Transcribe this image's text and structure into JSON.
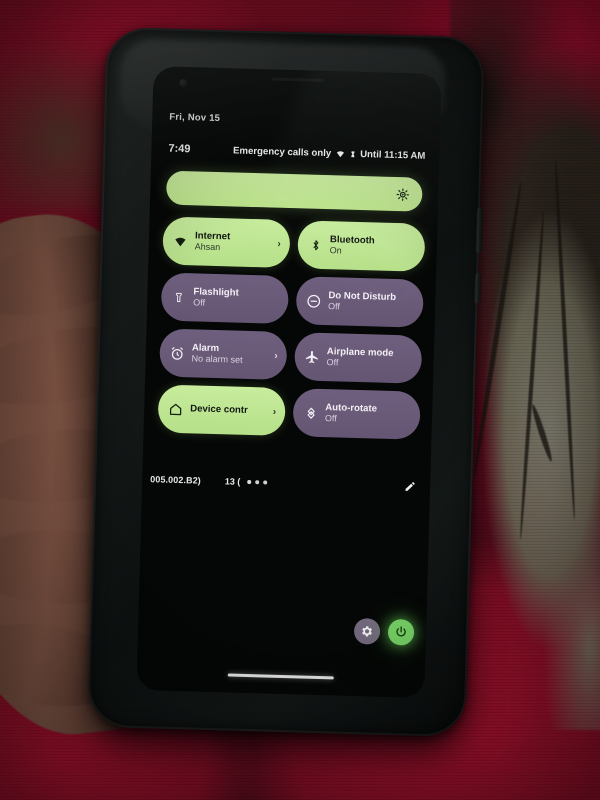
{
  "scene": {
    "description": "photo-of-android-phone-quick-settings-held-in-hand",
    "background": "red floral patterned fabric"
  },
  "colors": {
    "tile_on": "#bee68d",
    "tile_off": "#6a5a79",
    "screen_bg": "#050706",
    "power_green": "#7ddc6b",
    "gear_grey": "#7a6f86",
    "fabric_red": "#9c0c2c",
    "fabric_grey": "#85826f"
  },
  "status_bar": {
    "date": "Fri, Nov 15",
    "clock": "7:49",
    "carrier": "Emergency calls only",
    "wifi_icon": "wifi-icon",
    "dnd_icon": "dnd-clock-icon",
    "dnd_text": "Until 11:15 AM"
  },
  "brightness": {
    "label": "Brightness",
    "icon": "brightness-icon",
    "value": 100
  },
  "tiles": [
    {
      "label": "Internet",
      "sub": "Ahsan",
      "state": "on",
      "icon": "wifi-icon",
      "chevron": "›"
    },
    {
      "label": "Bluetooth",
      "sub": "On",
      "state": "on",
      "icon": "bluetooth-icon",
      "chevron": ""
    },
    {
      "label": "Flashlight",
      "sub": "Off",
      "state": "off",
      "icon": "flashlight-icon",
      "chevron": ""
    },
    {
      "label": "Do Not Disturb",
      "sub": "Off",
      "state": "off",
      "icon": "dnd-icon",
      "chevron": ""
    },
    {
      "label": "Alarm",
      "sub": "No alarm set",
      "state": "off",
      "icon": "alarm-clock-icon",
      "chevron": "›"
    },
    {
      "label": "Airplane mode",
      "sub": "Off",
      "state": "off",
      "icon": "airplane-icon",
      "chevron": ""
    },
    {
      "label": "Device contr",
      "sub": "",
      "state": "on",
      "icon": "home-icon",
      "chevron": "›"
    },
    {
      "label": "Auto-rotate",
      "sub": "Off",
      "state": "off",
      "icon": "auto-rotate-icon",
      "chevron": ""
    }
  ],
  "footer": {
    "build_text": "005.002.B2)",
    "page_text": "13 (",
    "dots": 3,
    "active_dot": 1,
    "edit_icon": "pencil-icon"
  },
  "bottom_buttons": {
    "settings_icon": "gear-icon",
    "power_icon": "power-icon"
  },
  "navigation": {
    "gesture_pill": "home-gesture-pill"
  }
}
